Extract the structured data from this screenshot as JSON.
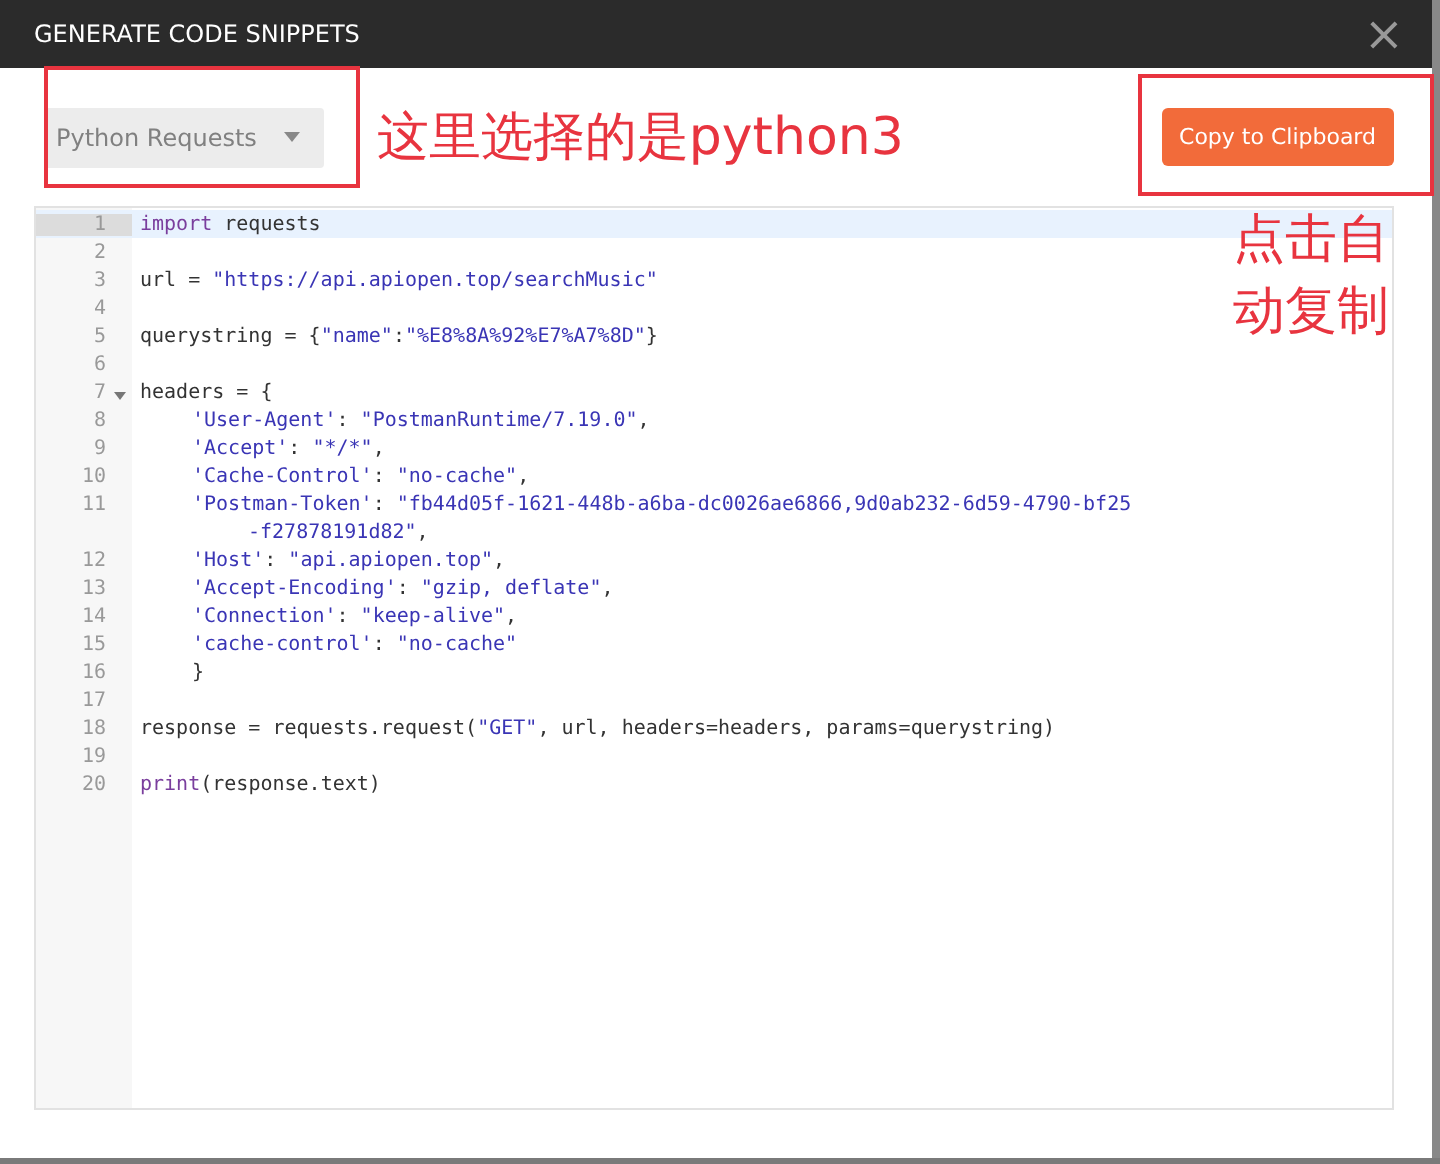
{
  "dialog": {
    "title": "GENERATE CODE SNIPPETS",
    "close": "×"
  },
  "language_select": {
    "value": "Python Requests"
  },
  "copy_button": {
    "label": "Copy to Clipboard"
  },
  "annotations": {
    "select_note": "这里选择的是python3",
    "copy_note": "点击自动复制"
  },
  "code_lines": [
    {
      "number": "1",
      "active": true,
      "segments": [
        {
          "kind": "keyword",
          "text": "import"
        },
        {
          "kind": "plain",
          "text": " requests"
        }
      ]
    },
    {
      "number": "2",
      "active": false
    },
    {
      "number": "3",
      "active": false,
      "segments": [
        {
          "kind": "plain",
          "text": "url = "
        },
        {
          "kind": "string",
          "text": "\"https://api.apiopen.top/searchMusic\""
        }
      ]
    },
    {
      "number": "4",
      "active": false
    },
    {
      "number": "5",
      "active": false,
      "segments": [
        {
          "kind": "plain",
          "text": "querystring = {"
        },
        {
          "kind": "string",
          "text": "\"name\""
        },
        {
          "kind": "plain",
          "text": ":"
        },
        {
          "kind": "string",
          "text": "\"%E8%8A%92%E7%A7%8D\""
        },
        {
          "kind": "plain",
          "text": "}"
        }
      ]
    },
    {
      "number": "6",
      "active": false
    },
    {
      "number": "7",
      "active": false,
      "foldable": true,
      "segments": [
        {
          "kind": "plain",
          "text": "headers = {"
        }
      ]
    },
    {
      "number": "8",
      "active": false,
      "indented": true,
      "segments": [
        {
          "kind": "string",
          "text": "'User-Agent'"
        },
        {
          "kind": "plain",
          "text": ": "
        },
        {
          "kind": "string",
          "text": "\"PostmanRuntime/7.19.0\""
        },
        {
          "kind": "plain",
          "text": ","
        }
      ]
    },
    {
      "number": "9",
      "active": false,
      "indented": true,
      "segments": [
        {
          "kind": "string",
          "text": "'Accept'"
        },
        {
          "kind": "plain",
          "text": ": "
        },
        {
          "kind": "string",
          "text": "\"*/*\""
        },
        {
          "kind": "plain",
          "text": ","
        }
      ]
    },
    {
      "number": "10",
      "active": false,
      "indented": true,
      "segments": [
        {
          "kind": "string",
          "text": "'Cache-Control'"
        },
        {
          "kind": "plain",
          "text": ": "
        },
        {
          "kind": "string",
          "text": "\"no-cache\""
        },
        {
          "kind": "plain",
          "text": ","
        }
      ]
    },
    {
      "number": "11",
      "active": false,
      "indented": true,
      "segments": [
        {
          "kind": "string",
          "text": "'Postman-Token'"
        },
        {
          "kind": "plain",
          "text": ": "
        },
        {
          "kind": "string",
          "text": "\"fb44d05f-1621-448b-a6ba-dc0026ae6866,9d0ab232-6d59-4790-bf25"
        }
      ],
      "continuation": [
        {
          "kind": "string",
          "text": "-f27878191d82\""
        },
        {
          "kind": "plain",
          "text": ","
        }
      ]
    },
    {
      "number": "12",
      "active": false,
      "indented": true,
      "segments": [
        {
          "kind": "string",
          "text": "'Host'"
        },
        {
          "kind": "plain",
          "text": ": "
        },
        {
          "kind": "string",
          "text": "\"api.apiopen.top\""
        },
        {
          "kind": "plain",
          "text": ","
        }
      ]
    },
    {
      "number": "13",
      "active": false,
      "indented": true,
      "segments": [
        {
          "kind": "string",
          "text": "'Accept-Encoding'"
        },
        {
          "kind": "plain",
          "text": ": "
        },
        {
          "kind": "string",
          "text": "\"gzip, deflate\""
        },
        {
          "kind": "plain",
          "text": ","
        }
      ]
    },
    {
      "number": "14",
      "active": false,
      "indented": true,
      "segments": [
        {
          "kind": "string",
          "text": "'Connection'"
        },
        {
          "kind": "plain",
          "text": ": "
        },
        {
          "kind": "string",
          "text": "\"keep-alive\""
        },
        {
          "kind": "plain",
          "text": ","
        }
      ]
    },
    {
      "number": "15",
      "active": false,
      "indented": true,
      "segments": [
        {
          "kind": "string",
          "text": "'cache-control'"
        },
        {
          "kind": "plain",
          "text": ": "
        },
        {
          "kind": "string",
          "text": "\"no-cache\""
        }
      ]
    },
    {
      "number": "16",
      "active": false,
      "indented": true,
      "segments": [
        {
          "kind": "plain",
          "text": "}"
        }
      ]
    },
    {
      "number": "17",
      "active": false
    },
    {
      "number": "18",
      "active": false,
      "segments": [
        {
          "kind": "plain",
          "text": "response = requests.request("
        },
        {
          "kind": "string",
          "text": "\"GET\""
        },
        {
          "kind": "plain",
          "text": ", url, headers=headers, params=querystring)"
        }
      ]
    },
    {
      "number": "19",
      "active": false
    },
    {
      "number": "20",
      "active": false,
      "segments": [
        {
          "kind": "keyword",
          "text": "print"
        },
        {
          "kind": "plain",
          "text": "(response.text)"
        }
      ]
    }
  ]
}
